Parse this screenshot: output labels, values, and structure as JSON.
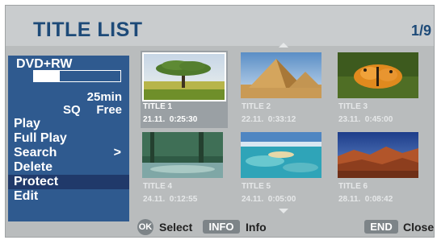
{
  "header": {
    "title": "TITLE LIST",
    "page": "1/9"
  },
  "disc": {
    "type": "DVD+RW",
    "used_fraction": 0.3,
    "remaining": "25min",
    "quality": "SQ",
    "free_label": "Free"
  },
  "menu": {
    "items": [
      {
        "label": "Play",
        "arrow": ""
      },
      {
        "label": "Full Play",
        "arrow": ""
      },
      {
        "label": "Search",
        "arrow": ">"
      },
      {
        "label": "Delete",
        "arrow": ""
      },
      {
        "label": "Protect",
        "arrow": "",
        "selected": true
      },
      {
        "label": "Edit",
        "arrow": ""
      }
    ]
  },
  "titles": [
    {
      "label": "TITLE 1",
      "date": "21.11.  0:25:30",
      "scene": "tree"
    },
    {
      "label": "TITLE 2",
      "date": "22.11.  0:33:12",
      "scene": "pyramids"
    },
    {
      "label": "TITLE 3",
      "date": "23.11.  0:45:00",
      "scene": "butterfly"
    },
    {
      "label": "TITLE 4",
      "date": "24.11.  0:12:55",
      "scene": "forest-stream"
    },
    {
      "label": "TITLE 5",
      "date": "24.11.  0:05:00",
      "scene": "lagoon"
    },
    {
      "label": "TITLE 6",
      "date": "28.11.  0:08:42",
      "scene": "canyon"
    }
  ],
  "footer": {
    "ok_key": "OK",
    "select_label": "Select",
    "info_key": "INFO",
    "info_label": "Info",
    "end_key": "END",
    "close_label": "Close"
  },
  "colors": {
    "panel": "#2f5a8f",
    "title": "#1d4a78",
    "highlight": "#20396a"
  }
}
